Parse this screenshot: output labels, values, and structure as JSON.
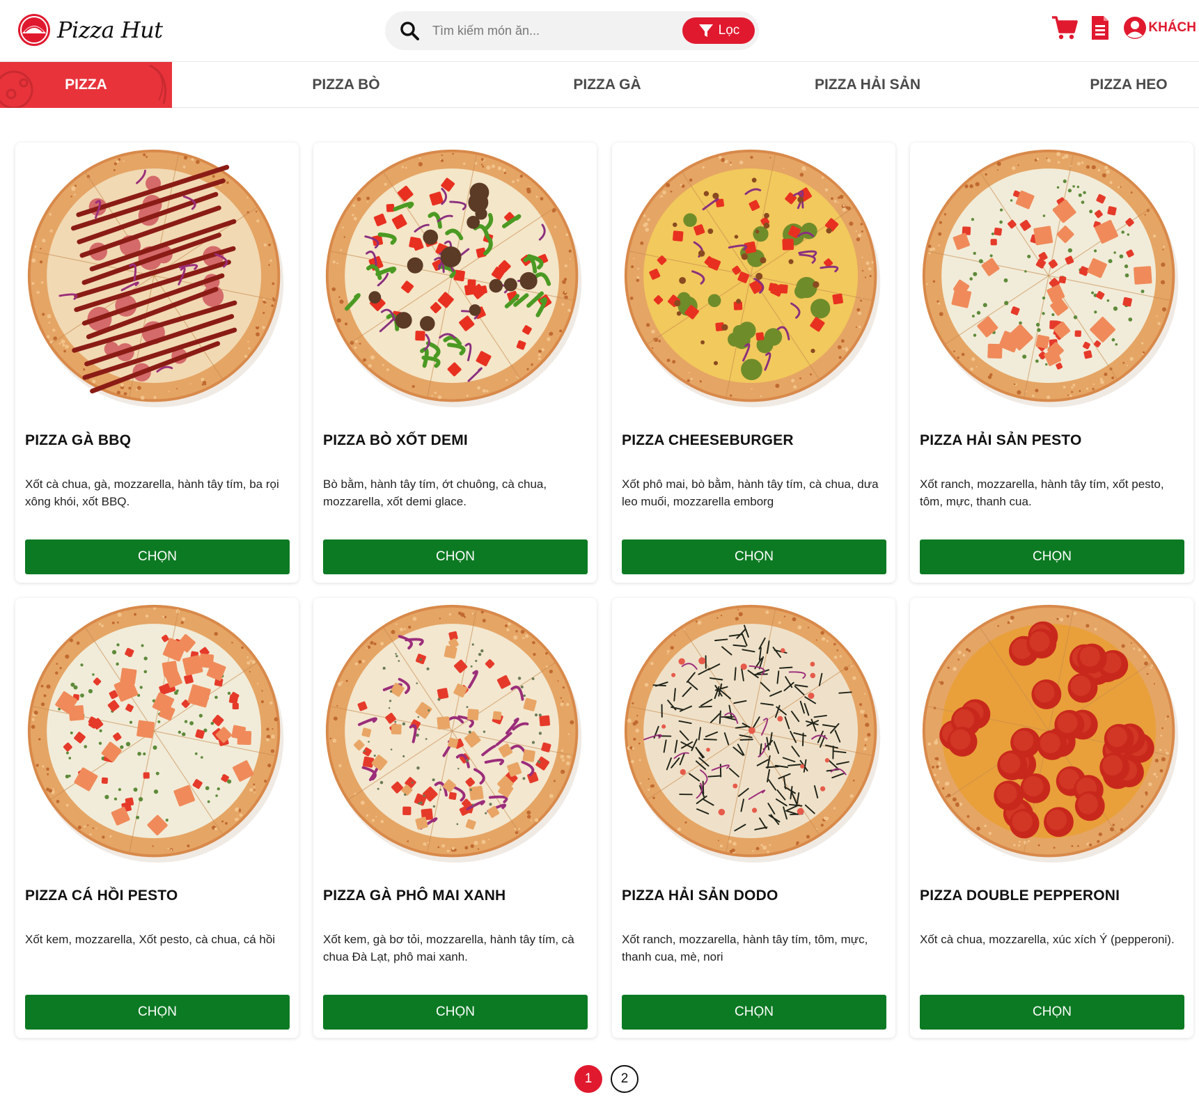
{
  "brand": {
    "name": "Pizza Hut",
    "color": "#e0192f"
  },
  "search": {
    "placeholder": "Tìm kiếm món ăn...",
    "filter_label": "Lọc"
  },
  "header": {
    "user_label": "KHÁCH"
  },
  "nav": {
    "items": [
      {
        "label": "PIZZA",
        "active": true
      },
      {
        "label": "PIZZA BÒ",
        "active": false
      },
      {
        "label": "PIZZA GÀ",
        "active": false
      },
      {
        "label": "PIZZA HẢI SẢN",
        "active": false
      },
      {
        "label": "PIZZA HEO",
        "active": false
      }
    ]
  },
  "products": [
    {
      "name": "PIZZA GÀ BBQ",
      "description": "Xốt cà chua, gà, mozzarella, hành tây tím, ba rọi xông khói, xốt BBQ.",
      "button": "CHỌN",
      "topping": "bbq"
    },
    {
      "name": "PIZZA BÒ XỐT DEMI",
      "description": "Bò bằm, hành tây tím, ớt chuông, cà chua, mozzarella, xốt demi glace.",
      "button": "CHỌN",
      "topping": "demi"
    },
    {
      "name": "PIZZA CHEESEBURGER",
      "description": "Xốt phô mai, bò bằm, hành tây tím, cà chua, dưa leo muối, mozzarella emborg",
      "button": "CHỌN",
      "topping": "cheeseburger"
    },
    {
      "name": "PIZZA HẢI SẢN PESTO",
      "description": "Xốt ranch, mozzarella, hành tây tím, xốt pesto, tôm, mực, thanh cua.",
      "button": "CHỌN",
      "topping": "pesto"
    },
    {
      "name": "PIZZA CÁ HỒI PESTO",
      "description": "Xốt kem, mozzarella, Xốt pesto, cà chua, cá hồi",
      "button": "CHỌN",
      "topping": "salmon"
    },
    {
      "name": "PIZZA GÀ PHÔ MAI XANH",
      "description": "Xốt kem, gà bơ tỏi, mozzarella, hành tây tím, cà chua Đà Lạt, phô mai xanh.",
      "button": "CHỌN",
      "topping": "bluecheese"
    },
    {
      "name": "PIZZA HẢI SẢN DODO",
      "description": "Xốt ranch, mozzarella, hành tây tím, tôm, mực, thanh cua, mè, nori",
      "button": "CHỌN",
      "topping": "nori"
    },
    {
      "name": "PIZZA DOUBLE PEPPERONI",
      "description": "Xốt cà chua, mozzarella, xúc xích Ý (pepperoni).",
      "button": "CHỌN",
      "topping": "pepperoni"
    }
  ],
  "pagination": {
    "pages": [
      "1",
      "2"
    ],
    "current": "1"
  },
  "colors": {
    "accent": "#e0192f",
    "button_green": "#0c7a23",
    "nav_active": "#e8333b"
  }
}
